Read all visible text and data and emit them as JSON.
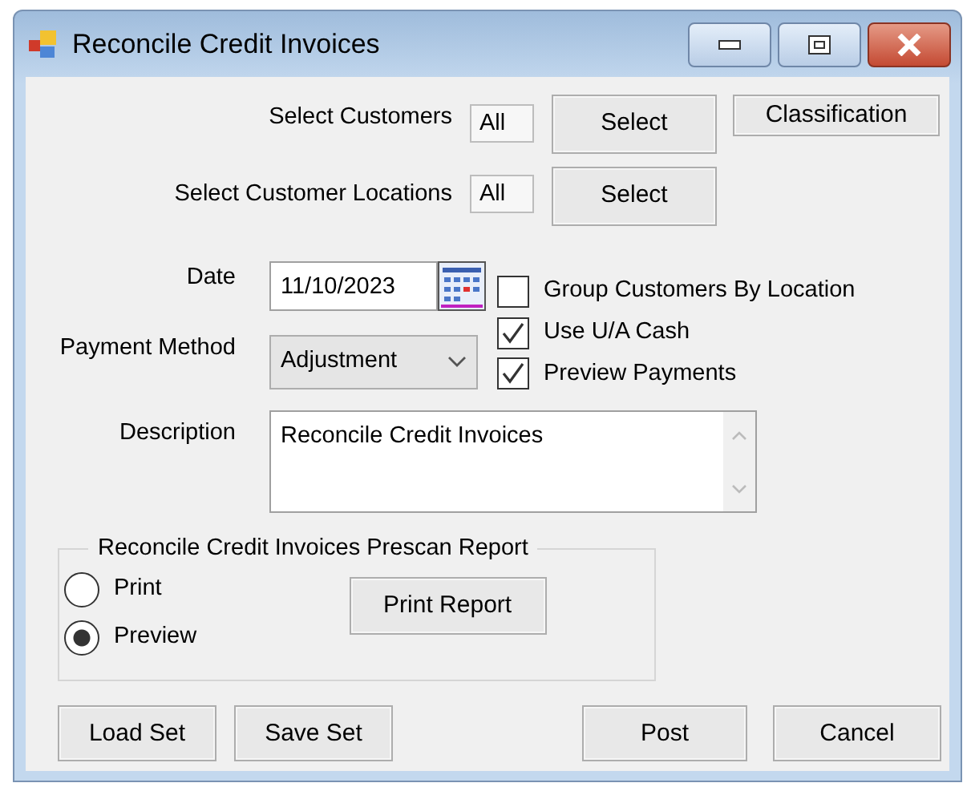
{
  "window": {
    "title": "Reconcile Credit Invoices"
  },
  "customers": {
    "label": "Select Customers",
    "value": "All",
    "button": "Select",
    "extra_button": "Classification"
  },
  "locations": {
    "label": "Select Customer Locations",
    "value": "All",
    "button": "Select"
  },
  "date": {
    "label": "Date",
    "value": "11/10/2023"
  },
  "payment_method": {
    "label": "Payment Method",
    "value": "Adjustment"
  },
  "options": [
    {
      "label": "Group Customers By Location",
      "checked": false
    },
    {
      "label": "Use U/A Cash",
      "checked": true
    },
    {
      "label": "Preview Payments",
      "checked": true
    }
  ],
  "description": {
    "label": "Description",
    "value": "Reconcile Credit Invoices"
  },
  "prescan": {
    "title": "Reconcile Credit Invoices Prescan Report",
    "options": [
      {
        "label": "Print",
        "selected": false
      },
      {
        "label": "Preview",
        "selected": true
      }
    ],
    "button": "Print Report"
  },
  "buttons": [
    "Load Set",
    "Save Set",
    "Post",
    "Cancel"
  ]
}
